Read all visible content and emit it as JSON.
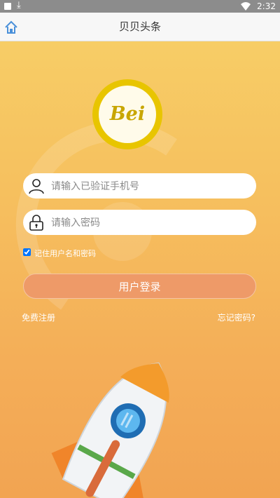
{
  "status": {
    "time": "2:32"
  },
  "header": {
    "title": "贝贝头条"
  },
  "logo": {
    "text": "Bei"
  },
  "phone": {
    "placeholder": "请输入已验证手机号",
    "value": ""
  },
  "password": {
    "placeholder": "请输入密码",
    "value": ""
  },
  "remember": {
    "label": "记住用户名和密码",
    "checked": true
  },
  "login": {
    "label": "用户登录"
  },
  "links": {
    "register": "免费注册",
    "forgot": "忘记密码?"
  },
  "colors": {
    "logo_ring": "#e8c500",
    "button": "#ee9a68",
    "bg_top": "#f7cd66",
    "bg_bottom": "#f2a452"
  },
  "icons": {
    "home": "home-icon",
    "user": "user-icon",
    "lock": "lock-icon",
    "rocket": "rocket-illustration"
  }
}
